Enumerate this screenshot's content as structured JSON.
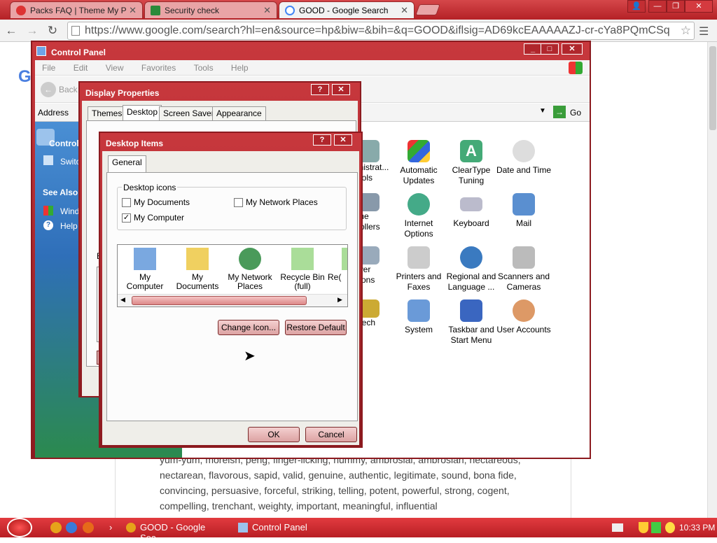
{
  "browser": {
    "tabs": [
      {
        "label": "Packs FAQ | Theme My PC",
        "favicon": "theme-my-pc-icon"
      },
      {
        "label": "Security check",
        "favicon": "security-icon"
      },
      {
        "label": "GOOD - Google Search",
        "favicon": "google-icon",
        "active": true
      }
    ],
    "url": "https://www.google.com/search?hl=en&source=hp&biw=&bih=&q=GOOD&iflsig=AD69kcEAAAAAZJ-cr-cYa8PQmCSq"
  },
  "control_panel": {
    "title": "Control Panel",
    "menu": [
      "File",
      "Edit",
      "View",
      "Favorites",
      "Tools",
      "Help"
    ],
    "back_label": "Back",
    "address_label": "Address",
    "go_label": "Go",
    "sidebar": {
      "heading": "Control",
      "switch": "Switc",
      "see_also": "See Also",
      "windows": "Wind",
      "help": "Help"
    },
    "items": [
      {
        "label": "Administrat... Tools",
        "short": "inistrat...\nools"
      },
      {
        "label": "Automatic Updates"
      },
      {
        "label": "ClearType Tuning"
      },
      {
        "label": "Date and Time"
      },
      {
        "label": "Game Controllers",
        "short": "me\nrollers"
      },
      {
        "label": "Internet Options"
      },
      {
        "label": "Keyboard"
      },
      {
        "label": "Mail"
      },
      {
        "label": "Power Options",
        "short": "wer\ntions"
      },
      {
        "label": "Printers and Faxes"
      },
      {
        "label": "Regional and Language ..."
      },
      {
        "label": "Scanners and Cameras"
      },
      {
        "label": "Speech",
        "short": "eech"
      },
      {
        "label": "System"
      },
      {
        "label": "Taskbar and Start Menu"
      },
      {
        "label": "User Accounts"
      }
    ]
  },
  "display_properties": {
    "title": "Display Properties",
    "tabs": [
      "Themes",
      "Desktop",
      "Screen Saver",
      "Appearance"
    ],
    "partial_label": "E"
  },
  "desktop_items": {
    "title": "Desktop Items",
    "tab": "General",
    "group_label": "Desktop icons",
    "checkboxes": [
      {
        "label": "My Documents",
        "checked": false
      },
      {
        "label": "My Network Places",
        "checked": false
      },
      {
        "label": "My Computer",
        "checked": true
      }
    ],
    "icons": [
      "My Computer",
      "My Documents",
      "My Network Places",
      "Recycle Bin (full)",
      "Re("
    ],
    "change_icon": "Change Icon...",
    "restore_default": "Restore Default",
    "ok": "OK",
    "cancel": "Cancel"
  },
  "results_text": [
    "yum-yum, moreish, peng, finger-licking, nummy, ambrosial, ambrosian, nectareous,",
    "nectarean, flavorous, sapid, valid, genuine, authentic, legitimate, sound, bona fide,",
    "convincing, persuasive, forceful, striking, telling, potent, powerful, strong, cogent,",
    "compelling, trenchant, weighty, important, meaningful, influential"
  ],
  "taskbar": {
    "items": [
      "GOOD - Google Sea...",
      "Control Panel"
    ],
    "clock": "10:33 PM"
  },
  "colors": {
    "theme_red": "#b42126",
    "xp_blue": "#2f6fb9"
  }
}
